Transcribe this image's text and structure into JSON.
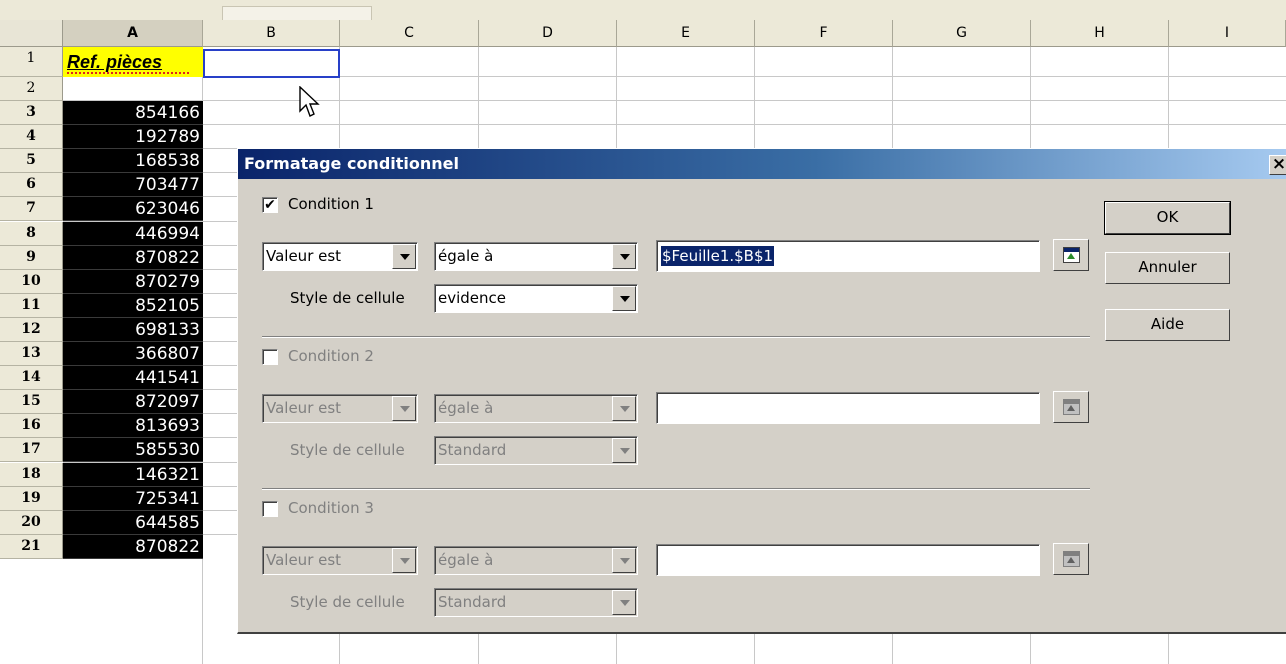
{
  "sheet": {
    "columns": [
      "A",
      "B",
      "C",
      "D",
      "E",
      "F",
      "G",
      "H",
      "I"
    ],
    "rows": [
      "1",
      "2",
      "3",
      "4",
      "5",
      "6",
      "7",
      "8",
      "9",
      "10",
      "11",
      "12",
      "13",
      "14",
      "15",
      "16",
      "17",
      "18",
      "19",
      "20",
      "21"
    ],
    "a1": "Ref. pièces",
    "values": [
      "854166",
      "192789",
      "168538",
      "703477",
      "623046",
      "446994",
      "870822",
      "870279",
      "852105",
      "698133",
      "366807",
      "441541",
      "872097",
      "813693",
      "585530",
      "146321",
      "725341",
      "644585",
      "870822"
    ]
  },
  "dialog": {
    "title": "Formatage conditionnel",
    "close_glyph": "×",
    "conditions": [
      {
        "label": "Condition 1",
        "accel": "1",
        "checked": true,
        "checkmark": "✔",
        "mode": "Valeur est",
        "operator": "égale à",
        "value": "$Feuille1.$B$1",
        "style_label": "Style de cellule",
        "style": "evidence",
        "enabled": true
      },
      {
        "label": "Condition 2",
        "accel": "2",
        "checked": false,
        "checkmark": "",
        "mode": "Valeur est",
        "operator": "égale à",
        "value": "",
        "style_label": "Style de cellule",
        "style": "Standard",
        "enabled": false
      },
      {
        "label": "Condition 3",
        "accel": "3",
        "checked": false,
        "checkmark": "",
        "mode": "Valeur est",
        "operator": "égale à",
        "value": "",
        "style_label": "Style de cellule",
        "style": "Standard",
        "enabled": false
      }
    ],
    "buttons": {
      "ok": "OK",
      "cancel": "Annuler",
      "help": "Aide"
    }
  }
}
